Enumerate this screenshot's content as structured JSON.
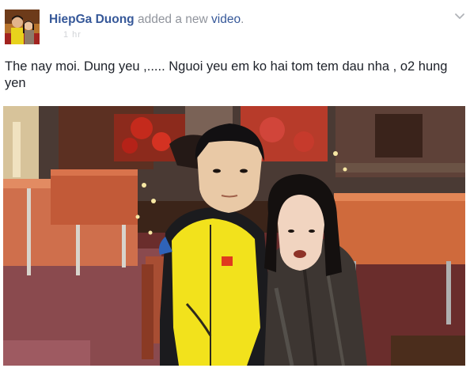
{
  "post": {
    "author": "HiepGa Duong",
    "action_prefix": "added a new",
    "action_link": "video",
    "action_suffix": ".",
    "meta_text": "1 hr",
    "text": "The nay moi. Dung yeu ,..... Nguoi yeu em ko hai tom tem dau nha , o2 hung yen"
  },
  "icons": {
    "menu": "chevron-down-icon"
  },
  "colors": {
    "link": "#365899",
    "text": "#1d2129",
    "muted": "#90949c",
    "jacket_yellow": "#f2e21c"
  }
}
